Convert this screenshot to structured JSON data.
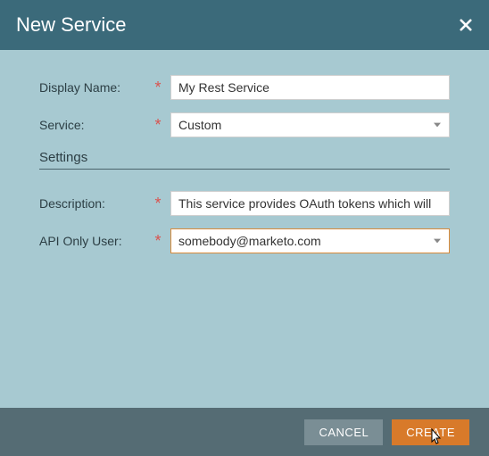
{
  "header": {
    "title": "New Service"
  },
  "form": {
    "displayName": {
      "label": "Display Name:",
      "value": "My Rest Service"
    },
    "service": {
      "label": "Service:",
      "value": "Custom"
    },
    "sectionTitle": "Settings",
    "description": {
      "label": "Description:",
      "value": "This service provides OAuth tokens which will"
    },
    "apiOnlyUser": {
      "label": "API Only User:",
      "value": "somebody@marketo.com"
    },
    "requiredMark": "*"
  },
  "footer": {
    "cancel": "CANCEL",
    "create": "CREATE"
  }
}
